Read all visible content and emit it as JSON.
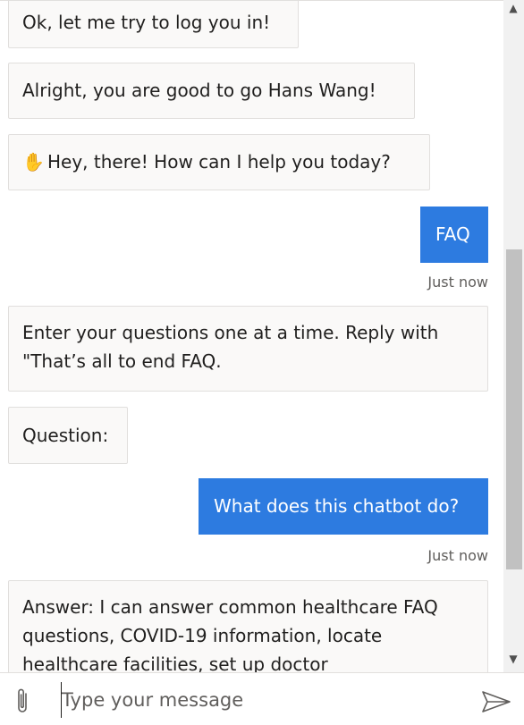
{
  "messages": [
    {
      "text": "Ok, let me try to log you in!"
    },
    {
      "text": "Alright, you are good to go Hans Wang!"
    },
    {
      "emoji": "✋",
      "text": "Hey, there! How can I help you today?"
    },
    {
      "text": "FAQ",
      "stamp": "Just now"
    },
    {
      "text": "Enter your questions one at a time. Reply with \"That’s all to end FAQ."
    },
    {
      "text": "Question:"
    },
    {
      "text": "What does this chatbot do?",
      "stamp": "Just now"
    },
    {
      "text": "Answer: I can answer common healthcare FAQ questions, COVID-19 information, locate healthcare facilities, set up doctor"
    }
  ],
  "composer": {
    "placeholder": "Type your message",
    "attach_icon": "paperclip-icon",
    "send_icon": "send-icon"
  },
  "colors": {
    "user_bubble": "#2d7be0",
    "bot_bubble": "#faf9f8"
  }
}
